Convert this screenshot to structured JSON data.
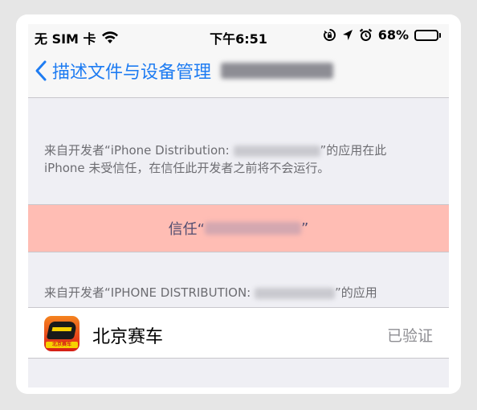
{
  "status_bar": {
    "carrier": "无 SIM 卡",
    "time": "下午6:51",
    "battery_percent": "68%",
    "battery_level": 0.68,
    "icons": [
      "wifi-icon",
      "rotation-lock-icon",
      "location-icon",
      "alarm-icon",
      "battery-icon"
    ]
  },
  "nav": {
    "back_title": "描述文件与设备管理"
  },
  "developer_section": {
    "prefix": "来自开发者“iPhone Distribution: ",
    "suffix": "”的应用在此",
    "line2": "iPhone 未受信任，在信任此开发者之前将不会运行。"
  },
  "trust_button": {
    "prefix": "信任“",
    "suffix": "”"
  },
  "apps_header": {
    "prefix": "来自开发者“IPHONE DISTRIBUTION: ",
    "suffix": "”的应用"
  },
  "apps": [
    {
      "name": "北京赛车",
      "status": "已验证",
      "icon_label": "北京赛车PK10"
    }
  ],
  "colors": {
    "accent": "#1e7cf2",
    "trust_bg": "#ffbdb4",
    "secondary_text": "#6d6d72",
    "grouped_bg": "#efeff4"
  }
}
